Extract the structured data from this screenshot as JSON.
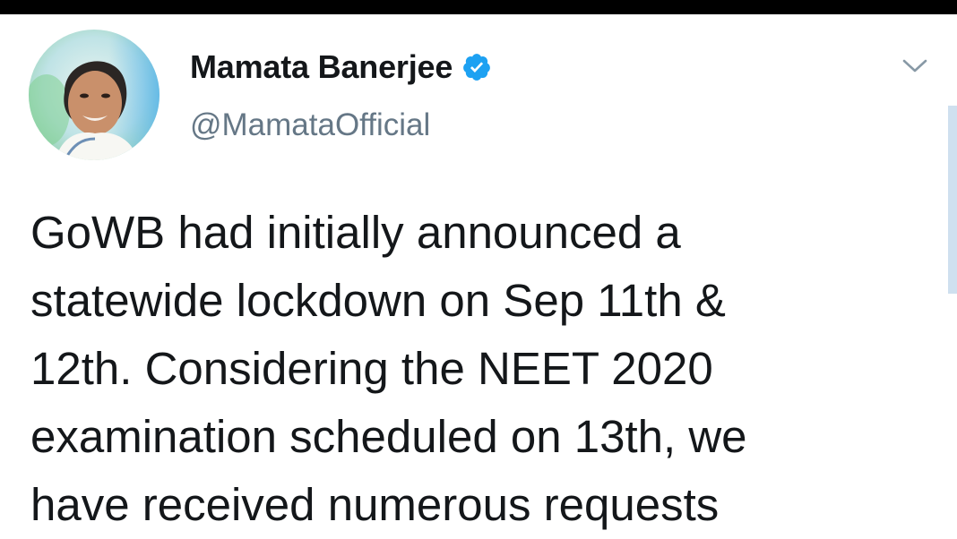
{
  "tweet": {
    "author": {
      "display_name": "Mamata Banerjee",
      "handle": "@MamataOfficial",
      "verified": true
    },
    "text_lines": [
      "GoWB had initially announced a",
      "statewide lockdown on Sep 11th &",
      "12th. Considering the NEET 2020",
      "examination scheduled on 13th, we",
      "have received numerous requests"
    ]
  },
  "icons": {
    "verified": "verified-badge-icon",
    "menu": "chevron-down-icon"
  },
  "colors": {
    "verified_blue": "#1da1f2",
    "handle_gray": "#657786",
    "text": "#14171a",
    "top_bar": "#000000",
    "scroll_indicator": "#cfe0ef"
  }
}
